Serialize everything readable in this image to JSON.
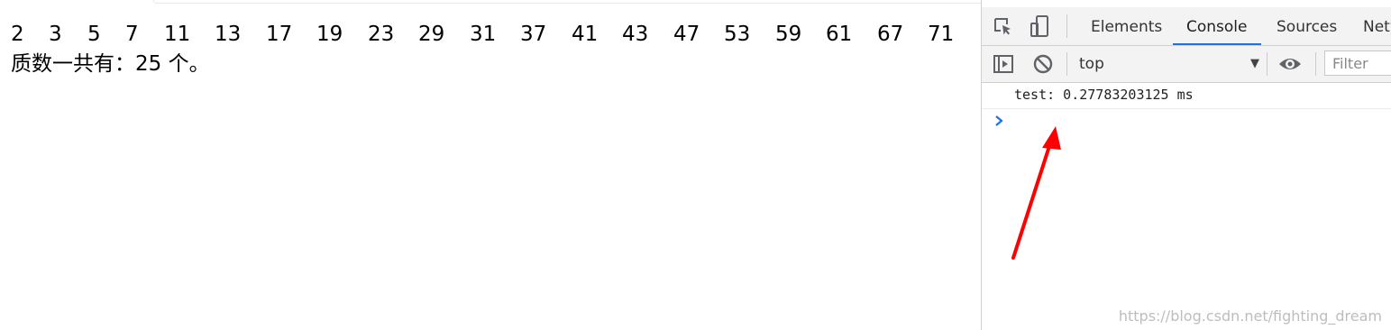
{
  "page": {
    "primes": [
      "2",
      "3",
      "5",
      "7",
      "11",
      "13",
      "17",
      "19",
      "23",
      "29",
      "31",
      "37",
      "41",
      "43",
      "47",
      "53",
      "59",
      "61",
      "67",
      "71"
    ],
    "count_text": "质数一共有：25 个。"
  },
  "devtools": {
    "tabs": [
      {
        "label": "Elements",
        "active": false
      },
      {
        "label": "Console",
        "active": true
      },
      {
        "label": "Sources",
        "active": false
      },
      {
        "label": "Netw",
        "active": false
      }
    ],
    "context": "top",
    "filter_placeholder": "Filter",
    "console_output": "test: 0.27783203125 ms",
    "accent_color": "#1a73e8"
  },
  "annotation": {
    "arrow_color": "#ff0000"
  },
  "watermark": "https://blog.csdn.net/fighting_dream"
}
